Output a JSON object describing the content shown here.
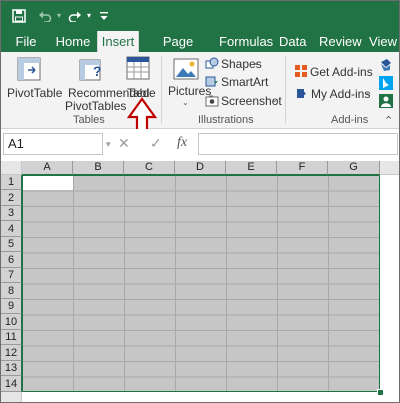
{
  "quick_access": {
    "save_icon": "save-icon",
    "undo_icon": "undo-icon",
    "redo_icon": "redo-icon",
    "customize_icon": "customize-toolbar-icon"
  },
  "tabs": [
    {
      "label": "File"
    },
    {
      "label": "Home"
    },
    {
      "label": "Insert",
      "active": true
    },
    {
      "label": "Page Layout"
    },
    {
      "label": "Formulas"
    },
    {
      "label": "Data"
    },
    {
      "label": "Review"
    },
    {
      "label": "View"
    }
  ],
  "ribbon": {
    "tables_group": {
      "label": "Tables",
      "pivottable": "PivotTable",
      "recommended_line1": "Recommended",
      "recommended_line2": "PivotTables",
      "table": "Table"
    },
    "illustrations_group": {
      "label": "Illustrations",
      "pictures": "Pictures",
      "shapes": "Shapes",
      "smartart": "SmartArt",
      "screenshot": "Screenshot"
    },
    "addins_group": {
      "label": "Add-ins",
      "get_addins": "Get Add-ins",
      "my_addins": "My Add-ins"
    }
  },
  "annotation": {
    "arrow_color": "#c00000",
    "points_to": "Table"
  },
  "formula_bar": {
    "name_box": "A1",
    "fx": "fx",
    "cancel": "✕",
    "enter": "✓",
    "formula_value": ""
  },
  "grid": {
    "columns": [
      "A",
      "B",
      "C",
      "D",
      "E",
      "F",
      "G"
    ],
    "rows": [
      "1",
      "2",
      "3",
      "4",
      "5",
      "6",
      "7",
      "8",
      "9",
      "10",
      "11",
      "12",
      "13",
      "14"
    ],
    "selection": "A1:G14",
    "active_cell": "A1"
  },
  "colors": {
    "accent": "#217346",
    "ribbon_bg": "#f3f3f3",
    "selection_fill": "#c6c6c6"
  }
}
